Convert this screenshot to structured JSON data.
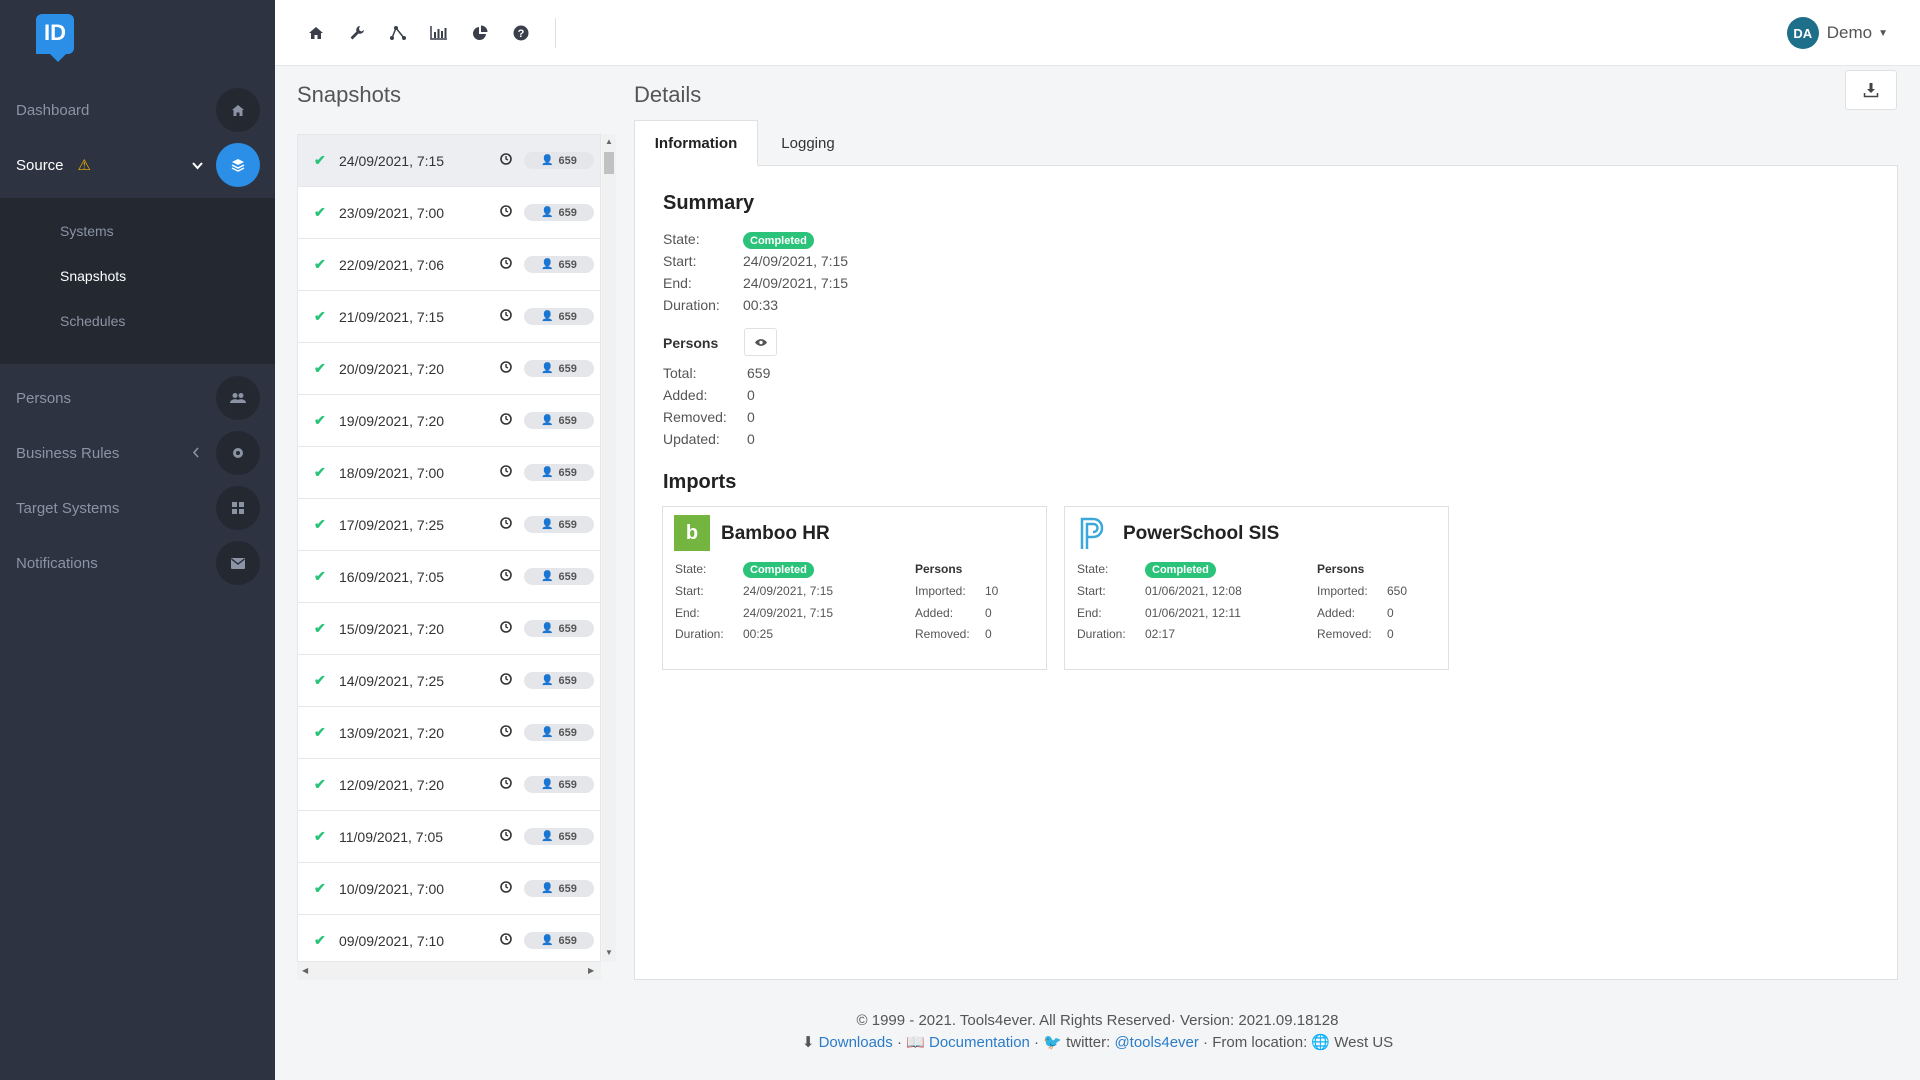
{
  "app": {
    "logo_text": "ID"
  },
  "sidebar": {
    "items": [
      {
        "label": "Dashboard",
        "icon": "home-icon"
      },
      {
        "label": "Source",
        "icon": "layers-icon",
        "warning": true
      },
      {
        "label": "Persons",
        "icon": "users-icon"
      },
      {
        "label": "Business Rules",
        "icon": "cogs-icon"
      },
      {
        "label": "Target Systems",
        "icon": "grid-icon"
      },
      {
        "label": "Notifications",
        "icon": "envelope-icon"
      }
    ],
    "submenu": [
      {
        "label": "Systems"
      },
      {
        "label": "Snapshots"
      },
      {
        "label": "Schedules"
      }
    ]
  },
  "topbar": {
    "icons": [
      "home-icon",
      "wrench-icon",
      "sitemap-icon",
      "bar-chart-icon",
      "pie-chart-icon",
      "help-icon"
    ],
    "user": {
      "initials": "DA",
      "name": "Demo"
    }
  },
  "snapshots": {
    "title": "Snapshots",
    "rows": [
      {
        "date": "24/09/2021, 7:15",
        "count": "659"
      },
      {
        "date": "23/09/2021, 7:00",
        "count": "659"
      },
      {
        "date": "22/09/2021, 7:06",
        "count": "659"
      },
      {
        "date": "21/09/2021, 7:15",
        "count": "659"
      },
      {
        "date": "20/09/2021, 7:20",
        "count": "659"
      },
      {
        "date": "19/09/2021, 7:20",
        "count": "659"
      },
      {
        "date": "18/09/2021, 7:00",
        "count": "659"
      },
      {
        "date": "17/09/2021, 7:25",
        "count": "659"
      },
      {
        "date": "16/09/2021, 7:05",
        "count": "659"
      },
      {
        "date": "15/09/2021, 7:20",
        "count": "659"
      },
      {
        "date": "14/09/2021, 7:25",
        "count": "659"
      },
      {
        "date": "13/09/2021, 7:20",
        "count": "659"
      },
      {
        "date": "12/09/2021, 7:20",
        "count": "659"
      },
      {
        "date": "11/09/2021, 7:05",
        "count": "659"
      },
      {
        "date": "10/09/2021, 7:00",
        "count": "659"
      },
      {
        "date": "09/09/2021, 7:10",
        "count": "659"
      }
    ]
  },
  "details": {
    "title": "Details",
    "tabs": [
      "Information",
      "Logging"
    ],
    "summary": {
      "heading": "Summary",
      "state_label": "State:",
      "state": "Completed",
      "start_label": "Start:",
      "start": "24/09/2021, 7:15",
      "end_label": "End:",
      "end": "24/09/2021, 7:15",
      "duration_label": "Duration:",
      "duration": "00:33"
    },
    "persons": {
      "heading": "Persons",
      "total_label": "Total:",
      "total": "659",
      "added_label": "Added:",
      "added": "0",
      "removed_label": "Removed:",
      "removed": "0",
      "updated_label": "Updated:",
      "updated": "0"
    },
    "imports": {
      "heading": "Imports",
      "cards": [
        {
          "name": "Bamboo HR",
          "logo_text": "b",
          "state_label": "State:",
          "state": "Completed",
          "start_label": "Start:",
          "start": "24/09/2021, 7:15",
          "end_label": "End:",
          "end": "24/09/2021, 7:15",
          "duration_label": "Duration:",
          "duration": "00:25",
          "persons_heading": "Persons",
          "imported_label": "Imported:",
          "imported": "10",
          "added_label": "Added:",
          "added": "0",
          "removed_label": "Removed:",
          "removed": "0"
        },
        {
          "name": "PowerSchool SIS",
          "logo_text": "P",
          "state_label": "State:",
          "state": "Completed",
          "start_label": "Start:",
          "start": "01/06/2021, 12:08",
          "end_label": "End:",
          "end": "01/06/2021, 12:11",
          "duration_label": "Duration:",
          "duration": "02:17",
          "persons_heading": "Persons",
          "imported_label": "Imported:",
          "imported": "650",
          "added_label": "Added:",
          "added": "0",
          "removed_label": "Removed:",
          "removed": "0"
        }
      ]
    }
  },
  "footer": {
    "line1": "© 1999 - 2021. Tools4ever. All Rights Reserved· Version: 2021.09.18128",
    "downloads": "Downloads",
    "sep1": " · ",
    "documentation": "Documentation",
    "sep2": " · ",
    "twitter_label": "twitter: ",
    "twitter_handle": "@tools4ever",
    "location": " · From location: ",
    "location_value": "West US"
  },
  "colors": {
    "sidebar_bg": "#2d3340",
    "accent": "#2b8fe8",
    "success": "#2bc37a",
    "warning": "#f0b400",
    "bamboo": "#73b53e",
    "powerschool": "#3aa8d8"
  }
}
